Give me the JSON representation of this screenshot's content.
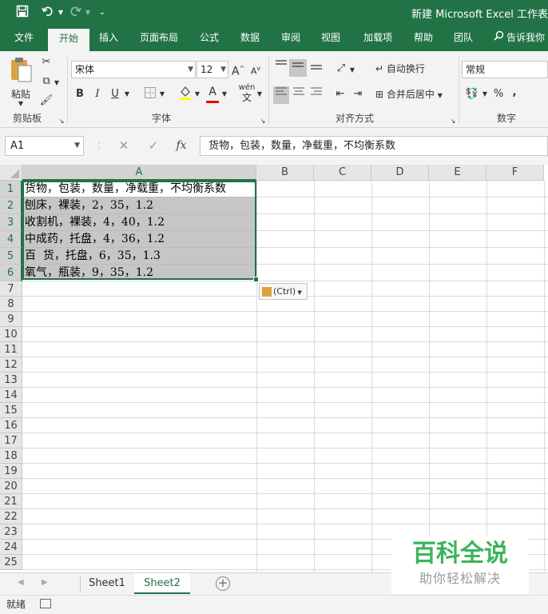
{
  "title_bar": {
    "save_icon": "save-icon",
    "undo_icon": "undo-icon",
    "redo_icon": "redo-icon",
    "customize_icon": "customize-qat-icon",
    "window_title": "新建 Microsoft Excel 工作表"
  },
  "ribbon_tabs": [
    "文件",
    "开始",
    "插入",
    "页面布局",
    "公式",
    "数据",
    "审阅",
    "视图",
    "加载项",
    "帮助",
    "团队"
  ],
  "active_tab": "开始",
  "search_tab": "告诉我你",
  "ribbon": {
    "clipboard": {
      "paste_label": "粘贴",
      "group_label": "剪贴板"
    },
    "font": {
      "font_name": "宋体",
      "font_size": "12",
      "bold": "B",
      "italic": "I",
      "underline": "U",
      "grow": "A",
      "shrink": "A",
      "font_color_label": "A",
      "phonetic": "wén",
      "group_label": "字体"
    },
    "alignment": {
      "wrap_text": "自动换行",
      "merge_center": "合并后居中",
      "group_label": "对齐方式"
    },
    "number": {
      "format": "常规",
      "percent": "%",
      "comma": ",",
      "group_label": "数字"
    }
  },
  "formula_bar": {
    "name_box": "A1",
    "cancel_icon": "cancel-icon",
    "enter_icon": "check-icon",
    "fx_label": "fx",
    "formula": "货物，包装，数量，净载重，不均衡系数"
  },
  "grid": {
    "columns": [
      "A",
      "B",
      "C",
      "D",
      "E",
      "F"
    ],
    "rows": [
      "1",
      "2",
      "3",
      "4",
      "5",
      "6",
      "7",
      "8",
      "9",
      "10",
      "11",
      "12",
      "13",
      "14",
      "15",
      "16",
      "17",
      "18",
      "19",
      "20",
      "21",
      "22",
      "23",
      "24",
      "25"
    ],
    "cells": [
      "货物，包装，数量，净载重，不均衡系数",
      "刨床，裸装，2，35，1.2",
      "收割机，裸装，4，40，1.2",
      "中成药，托盘，4，36，1.2",
      "百  货，托盘，6，35，1.3",
      "氧气，瓶装，9，35，1.2"
    ],
    "paste_options": "(Ctrl)"
  },
  "sheets": [
    "Sheet1",
    "Sheet2"
  ],
  "active_sheet": "Sheet2",
  "status": {
    "ready": "就绪"
  },
  "watermark": {
    "main": "百科全说",
    "sub": "助你轻松解决"
  },
  "colors": {
    "excel_green": "#217346",
    "selection_fill": "#c6c6c6",
    "watermark_green": "#3bb45b"
  }
}
